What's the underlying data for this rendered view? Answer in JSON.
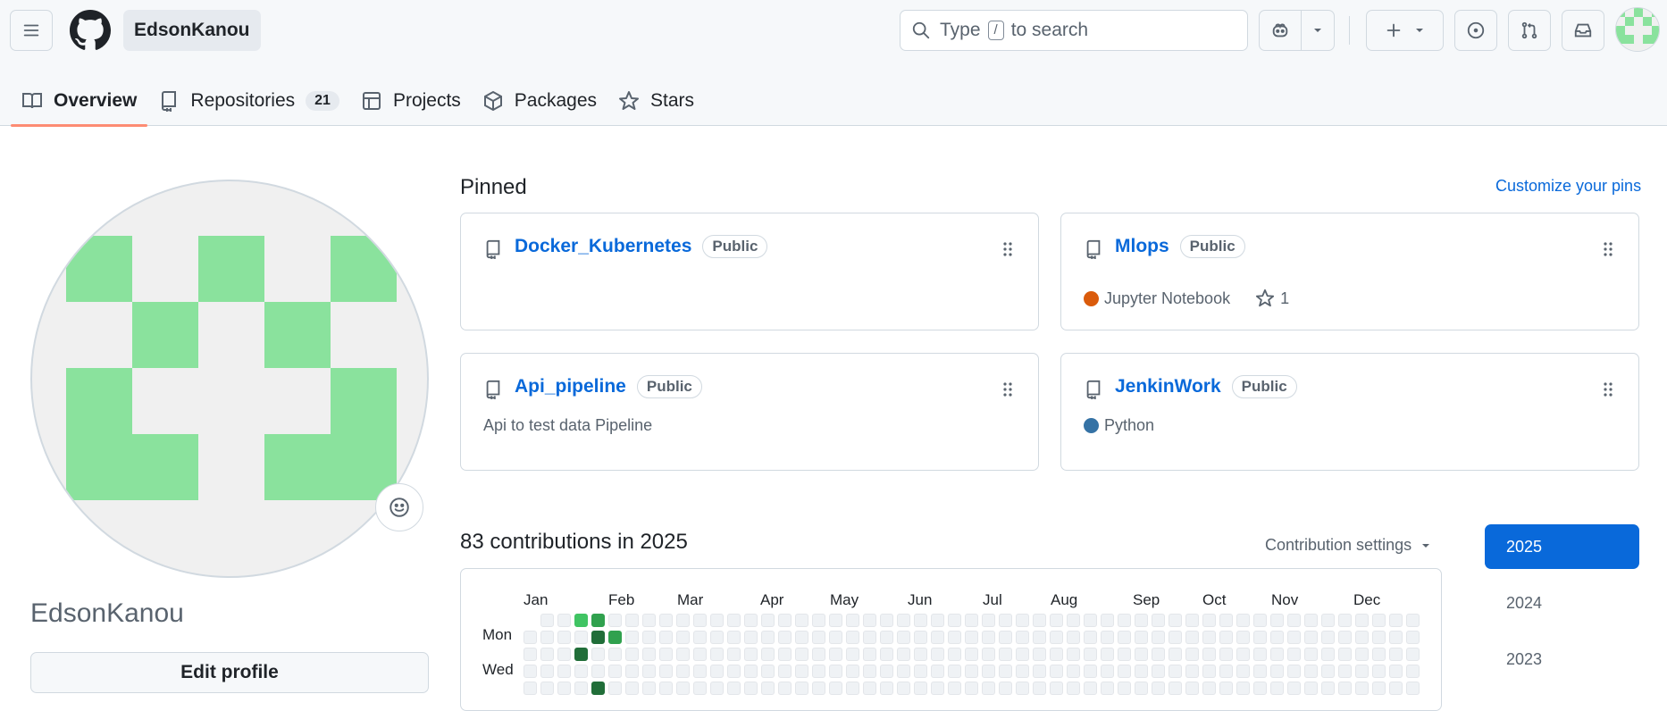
{
  "header": {
    "username_chip": "EdsonKanou",
    "search_pre": "Type",
    "search_key": "/",
    "search_post": "to search"
  },
  "tabs": [
    {
      "label": "Overview"
    },
    {
      "label": "Repositories",
      "count": "21"
    },
    {
      "label": "Projects"
    },
    {
      "label": "Packages"
    },
    {
      "label": "Stars"
    }
  ],
  "profile": {
    "display_name": "EdsonKanou",
    "edit_label": "Edit profile"
  },
  "pinned": {
    "heading": "Pinned",
    "customize": "Customize your pins",
    "repos": [
      {
        "name": "Docker_Kubernetes",
        "visibility": "Public",
        "description": "",
        "language": "",
        "stars": ""
      },
      {
        "name": "Mlops",
        "visibility": "Public",
        "language": "Jupyter Notebook",
        "language_color": "#DA5B0B",
        "stars": "1"
      },
      {
        "name": "Api_pipeline",
        "visibility": "Public",
        "description": "Api to test data Pipeline"
      },
      {
        "name": "JenkinWork",
        "visibility": "Public",
        "language": "Python",
        "language_color": "#3572A5"
      }
    ]
  },
  "contributions": {
    "heading": "83 contributions in 2025",
    "settings": "Contribution settings",
    "months": [
      "Jan",
      "Feb",
      "Mar",
      "Apr",
      "May",
      "Jun",
      "Jul",
      "Aug",
      "Sep",
      "Oct",
      "Nov",
      "Dec"
    ],
    "day_labels": [
      "Mon",
      "Wed"
    ],
    "level_colors": [
      "#eff2f5",
      "#9be9a8",
      "#40c463",
      "#30a14e",
      "#216e39"
    ],
    "active_cells": [
      {
        "week": 3,
        "day": 0,
        "level": 2
      },
      {
        "week": 4,
        "day": 0,
        "level": 3
      },
      {
        "week": 4,
        "day": 1,
        "level": 4
      },
      {
        "week": 5,
        "day": 1,
        "level": 3
      },
      {
        "week": 3,
        "day": 2,
        "level": 4
      },
      {
        "week": 4,
        "day": 4,
        "level": 4
      }
    ]
  },
  "years": [
    "2025",
    "2024",
    "2023"
  ]
}
